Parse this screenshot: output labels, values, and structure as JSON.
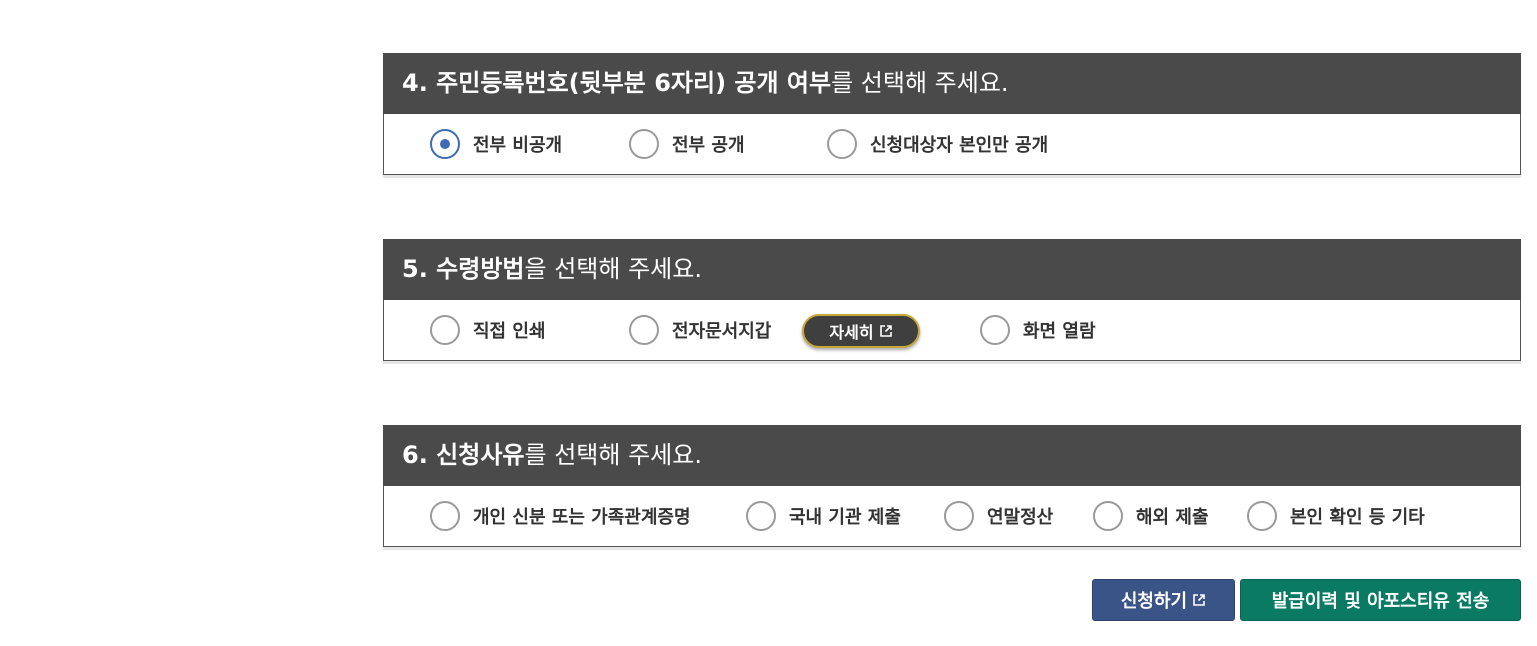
{
  "section4": {
    "title_bold": "4. 주민등록번호(뒷부분 6자리) 공개 여부",
    "title_rest": "를 선택해 주세요.",
    "options": [
      {
        "label": "전부 비공개",
        "checked": true
      },
      {
        "label": "전부 공개",
        "checked": false
      },
      {
        "label": "신청대상자 본인만 공개",
        "checked": false
      }
    ]
  },
  "section5": {
    "title_bold": "5. 수령방법",
    "title_rest": "을 선택해 주세요.",
    "options": [
      {
        "label": "직접 인쇄",
        "checked": false
      },
      {
        "label": "전자문서지갑",
        "checked": false
      },
      {
        "label": "화면 열람",
        "checked": false
      }
    ],
    "detail_button": "자세히"
  },
  "section6": {
    "title_bold": "6. 신청사유",
    "title_rest": "를 선택해 주세요.",
    "options": [
      {
        "label": "개인 신분 또는 가족관계증명",
        "checked": false
      },
      {
        "label": "국내 기관 제출",
        "checked": false
      },
      {
        "label": "연말정산",
        "checked": false
      },
      {
        "label": "해외 제출",
        "checked": false
      },
      {
        "label": "본인 확인 등 기타",
        "checked": false
      }
    ]
  },
  "buttons": {
    "apply": "신청하기",
    "history": "발급이력 및 아포스티유 전송"
  },
  "colors": {
    "header_bg": "#4a4a4a",
    "radio_checked": "#3d6cb4",
    "apply_bg": "#3b5488",
    "history_bg": "#0a7a63",
    "detail_border": "#c8a73a"
  },
  "icons": {
    "external_link": "external-link-icon"
  }
}
